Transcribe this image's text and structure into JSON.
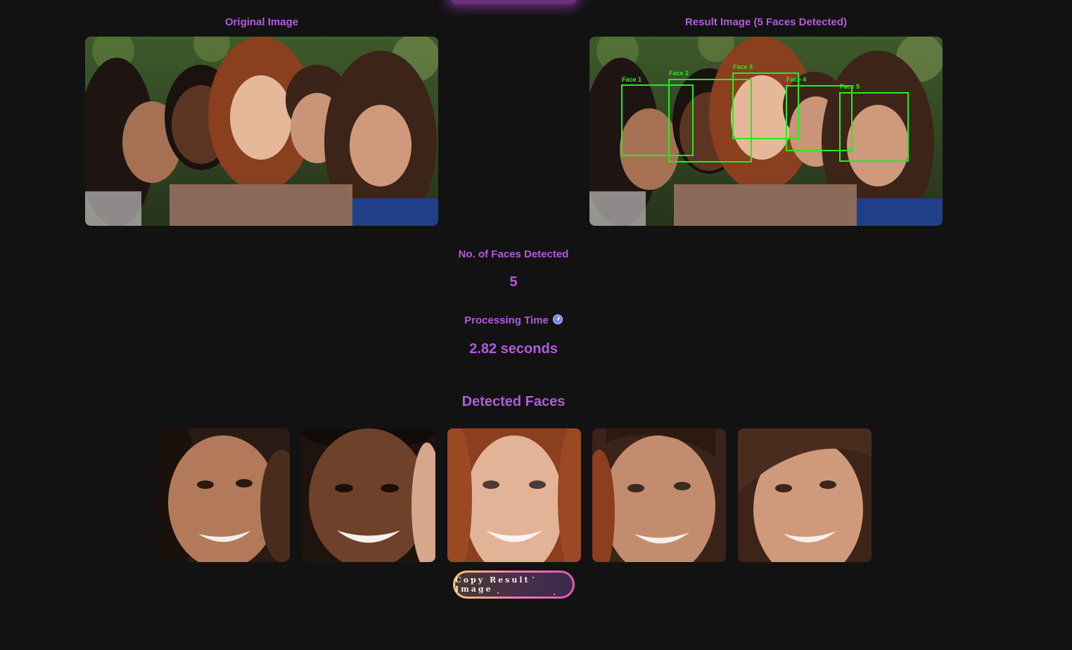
{
  "original": {
    "title": "Original Image"
  },
  "result": {
    "title": "Result Image (5 Faces Detected)",
    "box_labels": [
      "Face 1",
      "Face 2",
      "Face 3",
      "Face 4",
      "Face 5"
    ]
  },
  "stats": {
    "faces_label": "No. of Faces Detected",
    "faces_value": "5",
    "time_label": "Processing Time",
    "time_icon": "clock-icon",
    "time_value": "2.82 seconds"
  },
  "detected": {
    "heading": "Detected Faces",
    "count": 5
  },
  "actions": {
    "copy_label": "Copy Result Image"
  },
  "colors": {
    "accent": "#b15bdc",
    "background": "#121212",
    "detection_box": "#22ee22",
    "button_border_start": "#f7c86b",
    "button_border_end": "#e05aa8"
  }
}
